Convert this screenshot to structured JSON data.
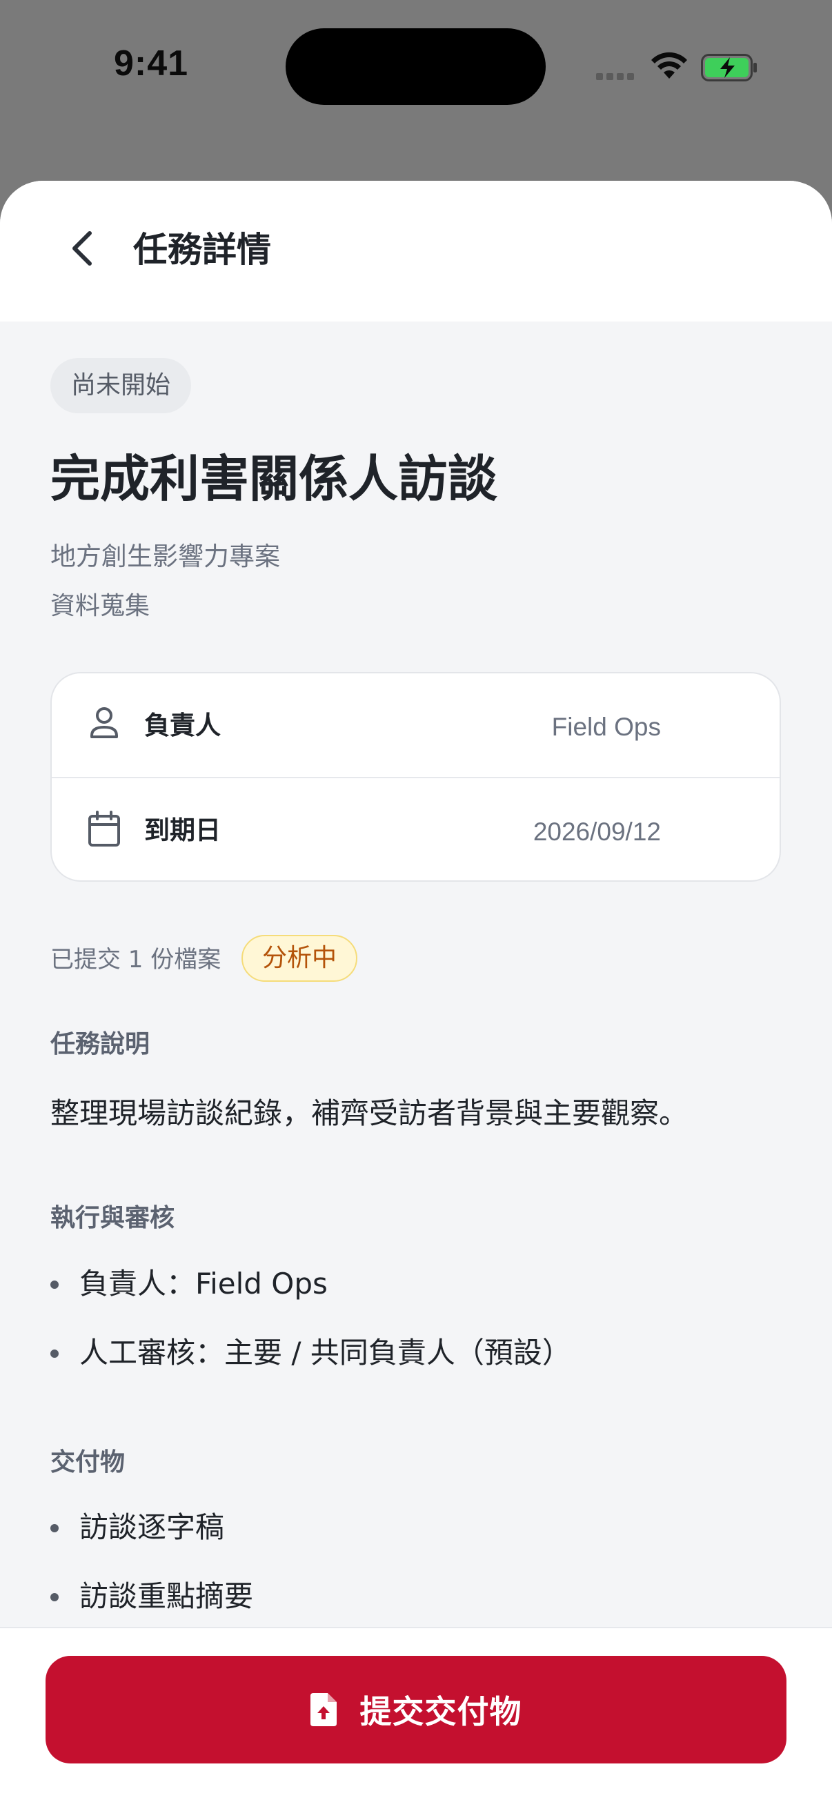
{
  "status_bar": {
    "time": "9:41"
  },
  "header": {
    "title": "任務詳情",
    "back_icon": "chevron-left-icon"
  },
  "task": {
    "status": "尚未開始",
    "title": "完成利害關係人訪談",
    "project": "地方創生影響力專案",
    "stage": "資料蒐集"
  },
  "info_card": {
    "rows": [
      {
        "icon": "person-icon",
        "label": "負責人",
        "value": "Field Ops"
      },
      {
        "icon": "calendar-icon",
        "label": "到期日",
        "value": "2026/09/12"
      }
    ]
  },
  "submission": {
    "text": "已提交 1 份檔案",
    "badge": "分析中"
  },
  "sections": {
    "description": {
      "heading": "任務說明",
      "text": "整理現場訪談紀錄，補齊受訪者背景與主要觀察。"
    },
    "execution": {
      "heading": "執行與審核",
      "items": [
        "負責人：Field Ops",
        "人工審核：主要 / 共同負責人（預設）"
      ]
    },
    "deliverables": {
      "heading": "交付物",
      "items": [
        "訪談逐字稿",
        "訪談重點摘要"
      ]
    }
  },
  "footer": {
    "submit_label": "提交交付物",
    "submit_icon": "file-upload-icon"
  },
  "colors": {
    "accent": "#c4102f",
    "badge_bg": "#fff7d6",
    "badge_text": "#b45309"
  }
}
